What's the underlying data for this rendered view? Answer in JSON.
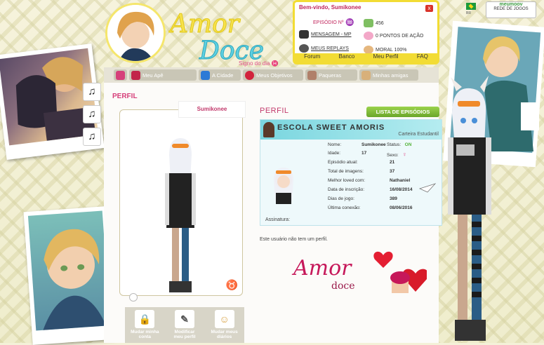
{
  "header": {
    "logo_line1": "Amor",
    "logo_line2": "Doce",
    "signo_label": "Signo do dia",
    "signo_symbol": "♓"
  },
  "welcome": {
    "title": "Bem-vindo, Sumikonee",
    "close": "x",
    "episode_label": "EPISÓDIO Nº",
    "episode_symbol": "♒",
    "messages": "MENSAGEM - MP",
    "replays": "MEUS REPLAYS",
    "coins": "456",
    "action_points": "0 PONTOS DE AÇÃO",
    "moral": "MORAL 100%",
    "links": [
      "Forum",
      "Banco",
      "Meu Perfil",
      "FAQ"
    ]
  },
  "topright": {
    "flag_label": "BR",
    "network_name": "meumoov",
    "network_label": "REDE DE JOGOS"
  },
  "nav": {
    "items": [
      {
        "label": "",
        "icon": "home-icon",
        "color": "#d63f7a"
      },
      {
        "label": "Meu Apê",
        "icon": "sofa-icon",
        "color": "#c2244a"
      },
      {
        "label": "A Cidade",
        "icon": "city-icon",
        "color": "#2c7ad6"
      },
      {
        "label": "Meus Objetivos",
        "icon": "target-icon",
        "color": "#d2233c"
      },
      {
        "label": "Paqueras",
        "icon": "people-icon",
        "color": "#b0806a"
      },
      {
        "label": "Minhas amigas",
        "icon": "friends-icon",
        "color": "#d8b07a"
      }
    ]
  },
  "panel": {
    "title": "PERFIL",
    "username_tab": "Sumikonee",
    "perfil_header": "PERFIL",
    "episodes_button": "LISTA DE EPISÓDIOS",
    "card_banner": "ESCOLA SWEET AMORIS",
    "card_subtitle": "Carteira Estudantil",
    "fields": {
      "name_label": "Nome:",
      "name_value": "Sumikonee",
      "status_label": "Status:",
      "status_value": "ON",
      "age_label": "Idade:",
      "age_value": "17",
      "sex_label": "Sexo:",
      "sex_value": "♀",
      "episode_label": "Episódio atual:",
      "episode_value": "21",
      "images_label": "Total de imagens:",
      "images_value": "37",
      "loved_label": "Melhor loved com:",
      "loved_value": "Nathaniel",
      "signup_label": "Data de inscrição:",
      "signup_value": "16/08/2014",
      "days_label": "Dias de jogo:",
      "days_value": "389",
      "last_label": "Última conexão:",
      "last_value": "08/06/2016"
    },
    "signature_label": "Assinatura:",
    "no_profile": "Este usuário não tem um perfil.",
    "ad_line1": "Amor",
    "ad_line2": "doce",
    "zodiac": "♉",
    "actions": [
      {
        "label": "Mudar minha conta",
        "icon": "lock-icon",
        "glyph": "🔒"
      },
      {
        "label": "Modificar meu perfil",
        "icon": "pen-icon",
        "glyph": "✎"
      },
      {
        "label": "Mudar meus diários",
        "icon": "diary-icon",
        "glyph": "☺"
      }
    ]
  },
  "music": {
    "glyph": "♫"
  }
}
